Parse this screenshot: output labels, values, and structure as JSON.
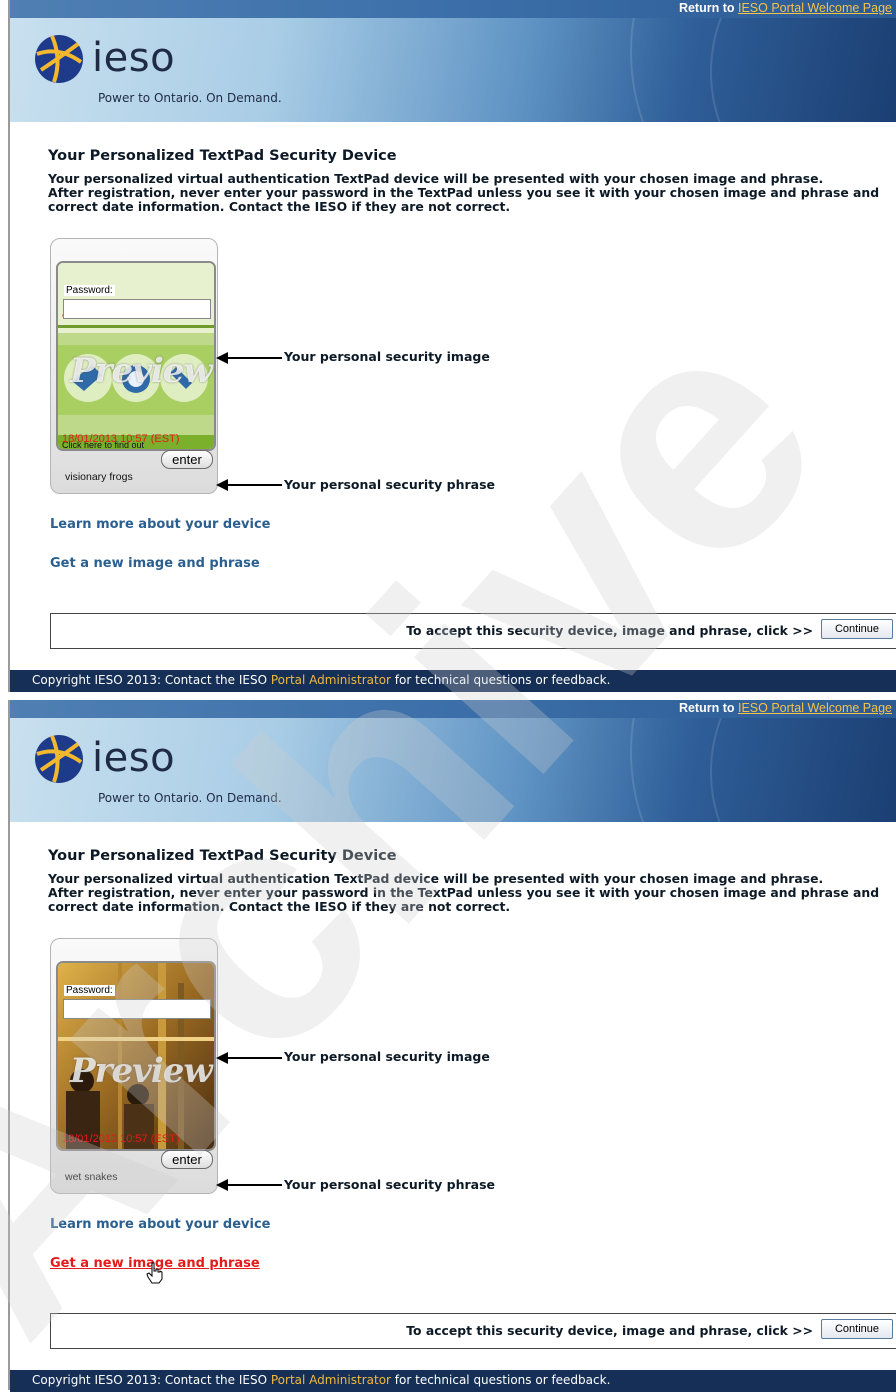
{
  "header": {
    "return_prefix": "Return to",
    "return_link": "IESO Portal Welcome Page",
    "brand": "ieso",
    "tagline": "Power to Ontario. On Demand."
  },
  "page": {
    "title": "Your Personalized TextPad Security Device",
    "desc_line1": "Your personalized virtual authentication TextPad device will be presented with your chosen image and phrase.",
    "desc_line2": "After registration, never enter your password in the TextPad unless you see it with your chosen image and phrase and",
    "desc_line3": "correct date information. Contact the IESO if they are not correct."
  },
  "device": {
    "password_label": "Password:",
    "preview_label": "Preview",
    "enter_label": "enter",
    "image_arrow_label": "Your personal security image",
    "phrase_arrow_label": "Your personal security phrase"
  },
  "panels": [
    {
      "phrase": "visionary frogs",
      "image_headline": "a kilowatt-hour?",
      "image_subline": "Click here to find out",
      "date_text": "18/01/2013 10:57 (EST)",
      "active_link": "none"
    },
    {
      "phrase": "wet snakes",
      "image_headline": "",
      "image_subline": "",
      "date_text": "18/01/2013 10:57 (EST)",
      "active_link": "get-new"
    }
  ],
  "links": {
    "learn_more": "Learn more about your device",
    "get_new": "Get a new image and phrase"
  },
  "accept": {
    "text": "To accept this security device, image and phrase, click >>",
    "button": "Continue"
  },
  "footer": {
    "before": "Copyright IESO 2013: Contact the IESO",
    "link": "Portal Administrator",
    "after": "for technical questions or feedback."
  },
  "watermark": "Archive",
  "colors": {
    "header_dark": "#1b3f73",
    "link_blue": "#2a5f8f",
    "link_active": "#e31b1b",
    "footer_bg": "#152f56",
    "footer_link": "#f3b93e"
  }
}
